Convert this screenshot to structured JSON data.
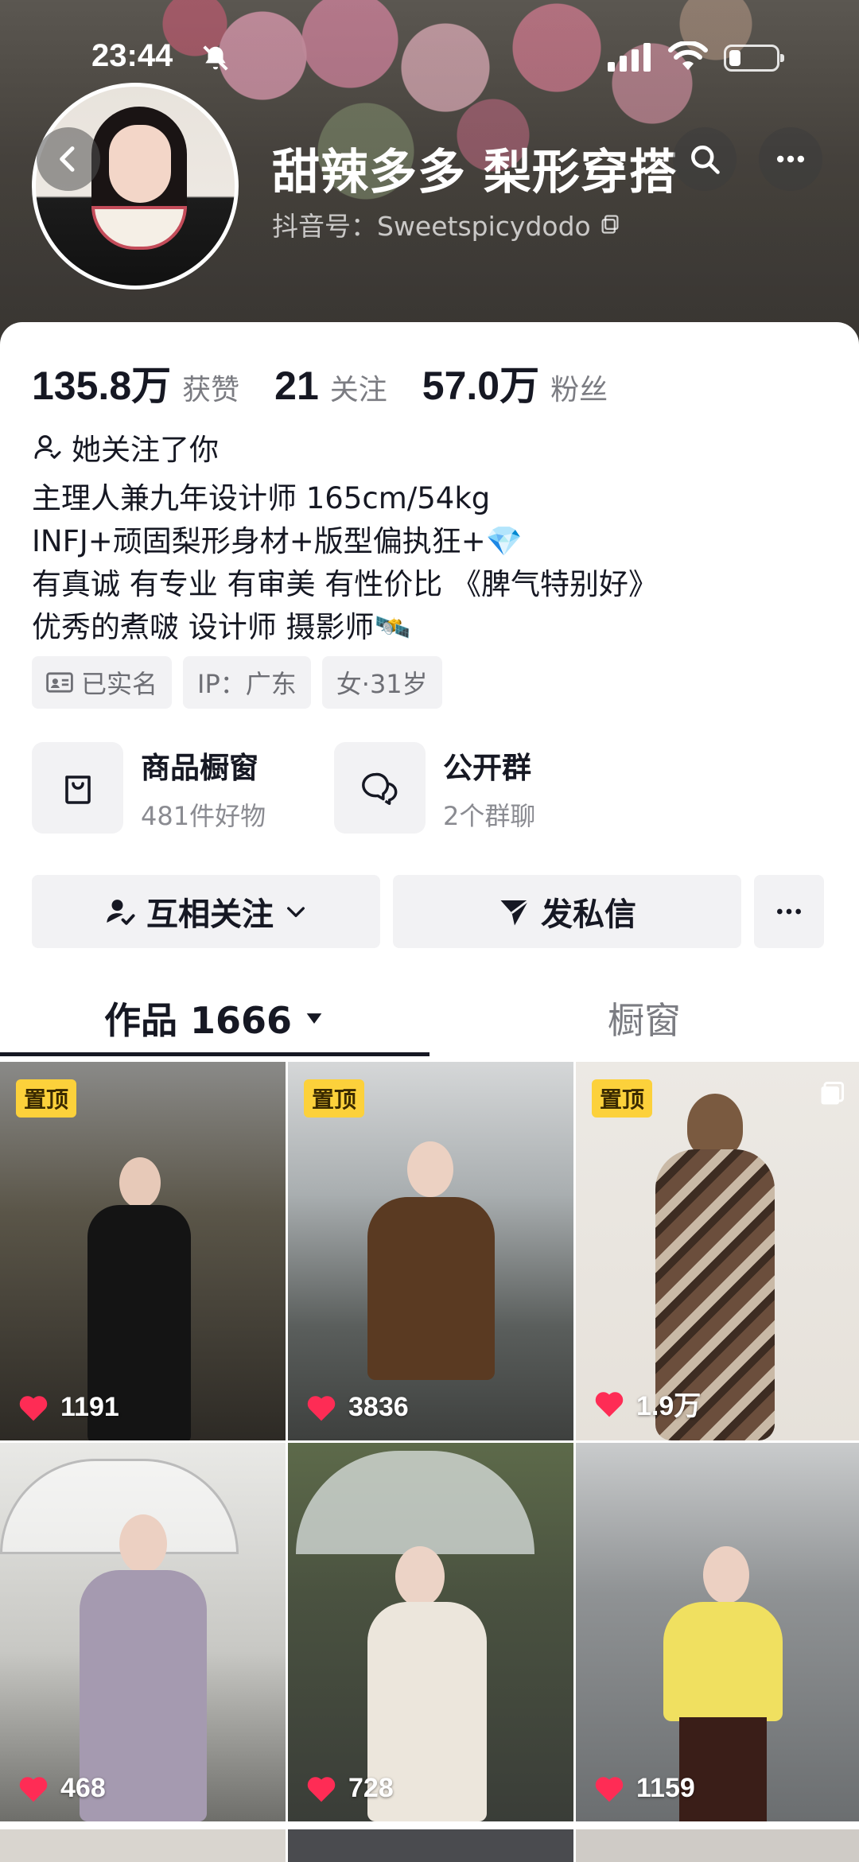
{
  "status_bar": {
    "time": "23:44"
  },
  "profile": {
    "nickname": "甜辣多多 梨形穿搭",
    "douyin_id": "抖音号：Sweetspicydodo",
    "stats": [
      {
        "value": "135.8万",
        "label": "获赞"
      },
      {
        "value": "21",
        "label": "关注"
      },
      {
        "value": "57.0万",
        "label": "粉丝"
      }
    ],
    "follows_you": "她关注了你",
    "bio": [
      "主理人兼九年设计师  165cm/54kg",
      "INFJ+顽固梨形身材+版型偏执狂+💎",
      "有真诚 有专业 有审美 有性价比 《脾气特别好》",
      "优秀的煮啵 设计师 摄影师🛰️"
    ],
    "tags": {
      "verified": "已实名",
      "ip": "IP：广东",
      "gender_age": "女·31岁"
    }
  },
  "entries": {
    "shop": {
      "title": "商品橱窗",
      "subtitle": "481件好物"
    },
    "group": {
      "title": "公开群",
      "subtitle": "2个群聊"
    }
  },
  "actions": {
    "follow": "互相关注",
    "message": "发私信"
  },
  "tabs": {
    "works": "作品 1666",
    "showcase": "橱窗"
  },
  "videos": [
    {
      "pinned": "置顶",
      "likes": "1191"
    },
    {
      "pinned": "置顶",
      "likes": "3836"
    },
    {
      "pinned": "置顶",
      "likes": "1.9万"
    },
    {
      "likes": "468"
    },
    {
      "likes": "728"
    },
    {
      "likes": "1159"
    }
  ],
  "colors": {
    "pinned_badge": "#fcd13b",
    "like_heart": "#fe2c55",
    "text_primary": "#161823"
  }
}
